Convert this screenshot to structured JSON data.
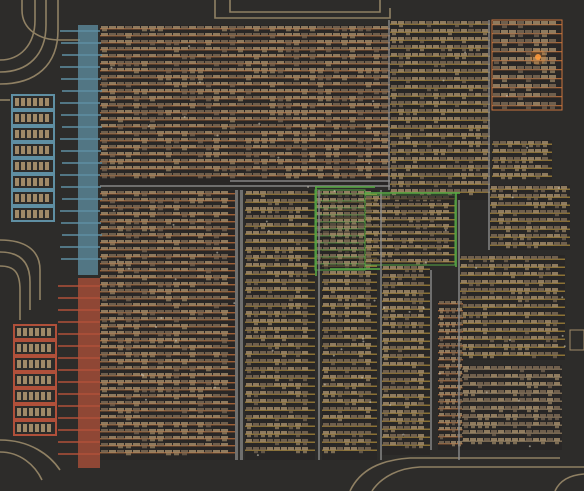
{
  "scene": {
    "kind": "factory-overview-map",
    "colors": {
      "ground": "#2d2c2a",
      "ground_dark": "#262523",
      "belt_yellow": "#b8943c",
      "belt_orange": "#c9753d",
      "belt_blue": "#5f8fa3",
      "belt_red": "#b0503a",
      "belt_green": "#58a845",
      "pipe_gray": "#8c8c8c",
      "machine": "#7b6a55",
      "machine_light": "#a08a68",
      "rail": "#9a8a6a",
      "power_glow": "#ff9a3c",
      "wire": "#c9c4b5"
    },
    "icons": {
      "glow": "power-glow-icon",
      "rail": "rail-curve-icon",
      "pole": "power-pole-icon"
    }
  }
}
